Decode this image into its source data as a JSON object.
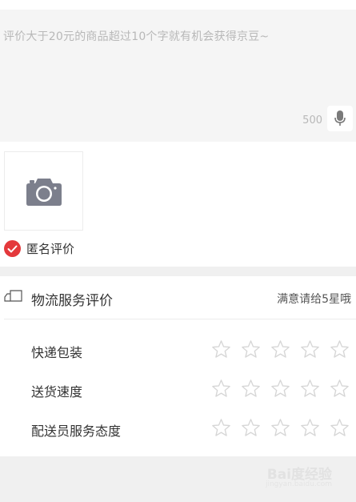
{
  "review": {
    "placeholder": "评价大于20元的商品超过10个字就有机会获得京豆~",
    "char_limit": "500"
  },
  "icons": {
    "mic": "microphone-icon",
    "photo": "camera-icon",
    "check": "checkmark-icon",
    "logistics": "truck-icon",
    "star": "star-outline-icon"
  },
  "anonymous": {
    "label": "匿名评价",
    "checked": true
  },
  "logistics": {
    "title": "物流服务评价",
    "hint": "满意请给5星哦",
    "ratings": [
      {
        "label": "快递包装",
        "stars": 0,
        "max": 5
      },
      {
        "label": "送货速度",
        "stars": 0,
        "max": 5
      },
      {
        "label": "配送员服务态度",
        "stars": 0,
        "max": 5
      }
    ]
  },
  "watermark": {
    "text": "Bai度经验",
    "sub": "jingyan.baidu.com"
  },
  "colors": {
    "accent": "#e4393c",
    "star_outline": "#d6d6d6",
    "panel_bg": "#f5f5f5"
  }
}
